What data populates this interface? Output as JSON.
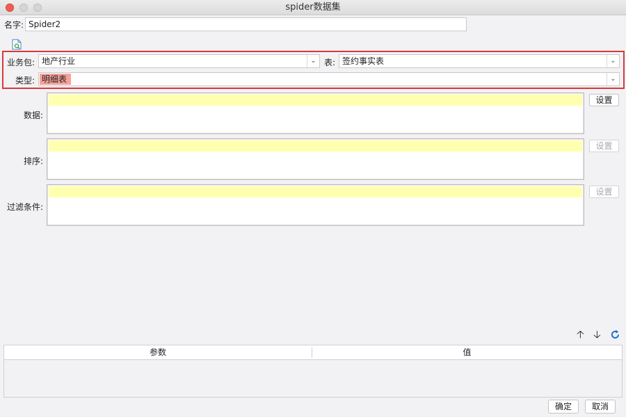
{
  "window": {
    "title": "spider数据集"
  },
  "name_row": {
    "label": "名字:",
    "value": "Spider2"
  },
  "selector": {
    "package_label": "业务包:",
    "package_value": "地产行业",
    "table_label": "表:",
    "table_value": "签约事实表",
    "type_label": "类型:",
    "type_value": "明细表"
  },
  "sections": {
    "data_label": "数据:",
    "sort_label": "排序:",
    "filter_label": "过滤条件:",
    "settings_label": "设置"
  },
  "params_table": {
    "columns": [
      "参数",
      "值"
    ]
  },
  "footer": {
    "ok_label": "确定",
    "cancel_label": "取消"
  },
  "icons": {
    "preview": "file-search-icon",
    "up": "arrow-up-icon",
    "down": "arrow-down-icon",
    "refresh": "refresh-icon"
  },
  "colors": {
    "highlight_row": "#ffffb0",
    "type_highlight": "#f6a19a",
    "red_frame": "#d9373b",
    "refresh_blue": "#1f6fd6"
  }
}
